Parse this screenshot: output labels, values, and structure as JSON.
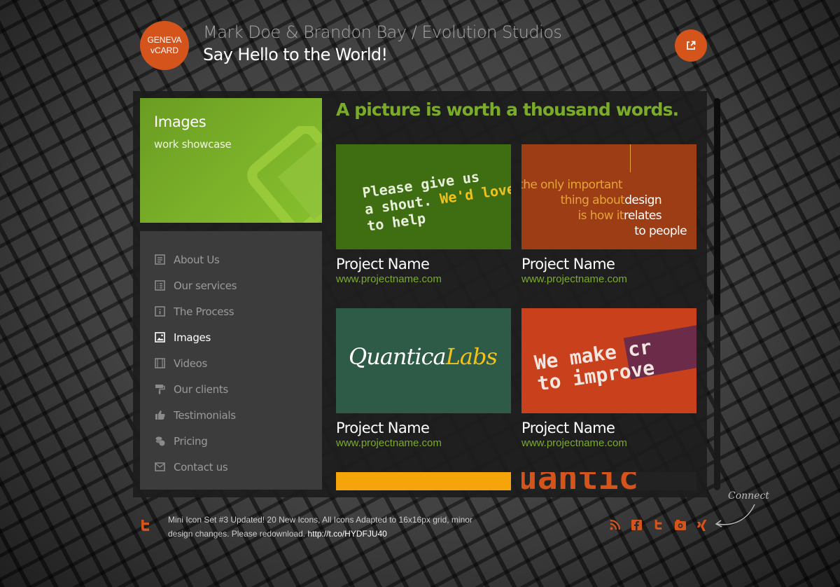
{
  "header": {
    "logo_line1": "GENEVA",
    "logo_line2": "vCARD",
    "title": "Mark Doe & Brandon Bay / Evolution Studios",
    "tagline": "Say Hello to the World!",
    "share_icon": "external-link-icon"
  },
  "feature": {
    "title": "Images",
    "subtitle": "work showcase",
    "icon": "image-icon"
  },
  "nav": {
    "items": [
      {
        "label": "About Us",
        "icon": "document-icon",
        "active": false
      },
      {
        "label": "Our services",
        "icon": "list-icon",
        "active": false
      },
      {
        "label": "The Process",
        "icon": "info-icon",
        "active": false
      },
      {
        "label": "Images",
        "icon": "image-icon",
        "active": true
      },
      {
        "label": "Videos",
        "icon": "video-icon",
        "active": false
      },
      {
        "label": "Our clients",
        "icon": "paint-roller-icon",
        "active": false
      },
      {
        "label": "Testimonials",
        "icon": "thumbs-up-icon",
        "active": false
      },
      {
        "label": "Pricing",
        "icon": "coins-icon",
        "active": false
      },
      {
        "label": "Contact us",
        "icon": "mail-icon",
        "active": false
      }
    ]
  },
  "content": {
    "heading": "A picture is worth a thousand words."
  },
  "projects": [
    {
      "name": "Project Name",
      "url": "www.projectname.com",
      "thumb_lines": [
        "Please give us",
        "a shout.",
        "We'd love",
        "to help"
      ]
    },
    {
      "name": "Project Name",
      "url": "www.projectname.com",
      "thumb_lines": [
        "the only important",
        "thing about",
        "design",
        "is how it",
        "relates",
        "to people"
      ]
    },
    {
      "name": "Project Name",
      "url": "www.projectname.com",
      "thumb_lines": [
        "Quantica",
        "Labs"
      ]
    },
    {
      "name": "Project Name",
      "url": "www.projectname.com",
      "thumb_lines": [
        "We make cr",
        "to improve"
      ]
    },
    {
      "thumb_lines": []
    },
    {
      "thumb_lines": [
        "uantic"
      ]
    }
  ],
  "footer": {
    "tweet_icon": "twitter-icon",
    "tweet_text": "Mini Icon Set #3 Updated! 20 New Icons, All Icons Adapted to 16x16px grid, minor design changes. Please redownload.",
    "tweet_link": "http://t.co/HYDFJU40",
    "connect_label": "Connect",
    "social": [
      "rss-icon",
      "facebook-icon",
      "twitter-icon",
      "camera-icon",
      "xing-icon"
    ]
  },
  "colors": {
    "accent_orange": "#d4541c",
    "accent_green": "#7aab2a",
    "panel_bg": "#1c1c1c",
    "nav_bg": "#3c3c3c"
  }
}
